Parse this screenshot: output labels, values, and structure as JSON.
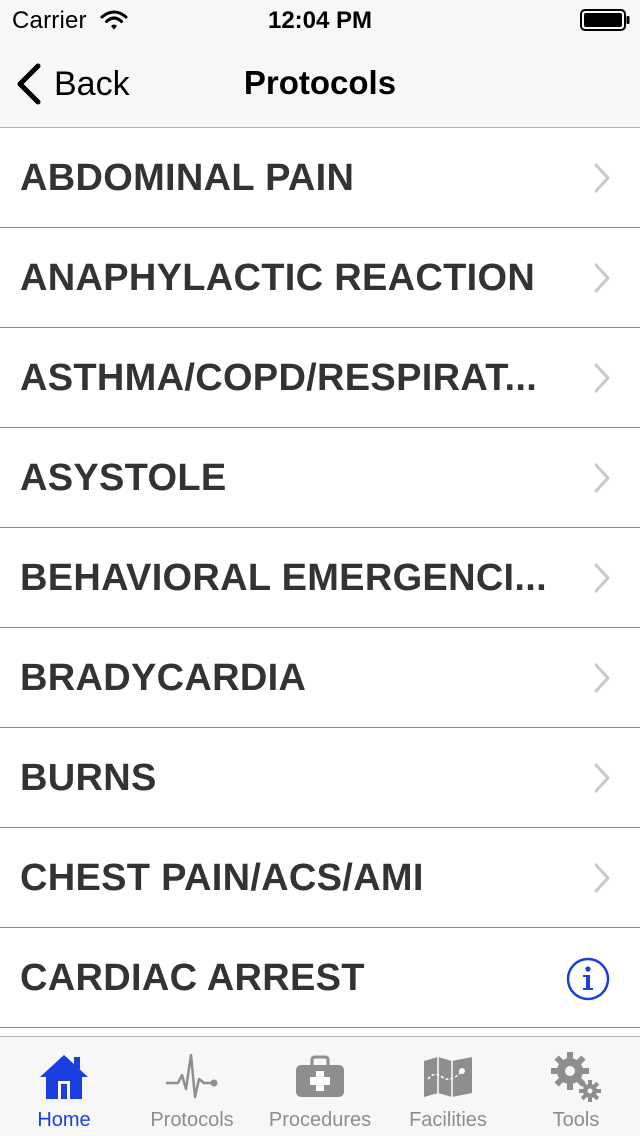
{
  "status": {
    "carrier": "Carrier",
    "time": "12:04 PM"
  },
  "nav": {
    "back_label": "Back",
    "title": "Protocols"
  },
  "rows": [
    {
      "label": "ABDOMINAL PAIN",
      "accessory": "chevron"
    },
    {
      "label": "ANAPHYLACTIC REACTION",
      "accessory": "chevron"
    },
    {
      "label": "ASTHMA/COPD/RESPIRAT...",
      "accessory": "chevron"
    },
    {
      "label": "ASYSTOLE",
      "accessory": "chevron"
    },
    {
      "label": "BEHAVIORAL EMERGENCI...",
      "accessory": "chevron"
    },
    {
      "label": "BRADYCARDIA",
      "accessory": "chevron"
    },
    {
      "label": "BURNS",
      "accessory": "chevron"
    },
    {
      "label": "CHEST PAIN/ACS/AMI",
      "accessory": "chevron"
    },
    {
      "label": "CARDIAC ARREST",
      "accessory": "info"
    }
  ],
  "tabs": [
    {
      "label": "Home",
      "icon": "home-icon",
      "active": true
    },
    {
      "label": "Protocols",
      "icon": "ekg-pulse-icon",
      "active": false
    },
    {
      "label": "Procedures",
      "icon": "medical-kit-icon",
      "active": false
    },
    {
      "label": "Facilities",
      "icon": "map-icon",
      "active": false
    },
    {
      "label": "Tools",
      "icon": "gears-icon",
      "active": false
    }
  ],
  "colors": {
    "accent": "#1a3fe0",
    "inactive_tab": "#8e8e8e",
    "row_text": "#333333",
    "chevron": "#c7c7cc"
  }
}
